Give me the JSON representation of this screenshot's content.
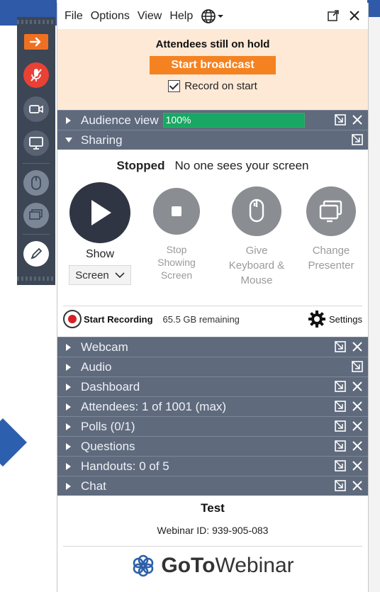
{
  "menu": {
    "file": "File",
    "options": "Options",
    "view": "View",
    "help": "Help"
  },
  "hold": {
    "title": "Attendees still on hold",
    "broadcast_button": "Start broadcast",
    "record_on_start": "Record on start",
    "record_on_start_checked": true
  },
  "audience_view": {
    "label": "Audience view",
    "percent_text": "100%",
    "progress_fraction": 1.0
  },
  "sharing": {
    "label": "Sharing",
    "status_bold": "Stopped",
    "status_text": "No one sees your screen",
    "buttons": {
      "show": "Show",
      "screen_select": "Screen",
      "stop_line1": "Stop",
      "stop_line2": "Showing",
      "stop_line3": "Screen",
      "give_line1": "Give",
      "give_line2": "Keyboard &",
      "give_line3": "Mouse",
      "change_line1": "Change",
      "change_line2": "Presenter"
    },
    "recording": {
      "start_label": "Start Recording",
      "remaining": "65.5 GB remaining",
      "settings": "Settings"
    }
  },
  "sections": [
    {
      "label": "Webcam",
      "icons": [
        "popout-icon",
        "close-icon"
      ]
    },
    {
      "label": "Audio",
      "icons": [
        "popout-icon"
      ]
    },
    {
      "label": "Dashboard",
      "icons": [
        "popout-icon",
        "close-icon"
      ]
    },
    {
      "label": "Attendees:  1 of 1001 (max)",
      "icons": [
        "popout-icon",
        "close-icon"
      ]
    },
    {
      "label": "Polls (0/1)",
      "icons": [
        "popout-icon",
        "close-icon"
      ]
    },
    {
      "label": "Questions",
      "icons": [
        "popout-icon",
        "close-icon"
      ]
    },
    {
      "label": "Handouts: 0 of 5",
      "icons": [
        "popout-icon",
        "close-icon"
      ]
    },
    {
      "label": "Chat",
      "icons": [
        "popout-icon",
        "close-icon"
      ]
    }
  ],
  "footer": {
    "webinar_name": "Test",
    "webinar_id": "Webinar ID: 939-905-083",
    "logo_bold": "GoTo",
    "logo_regular": "Webinar"
  },
  "colors": {
    "accent_orange": "#f58220",
    "hold_background": "#fde9d5",
    "section_bar": "#5f6a7d",
    "progress_green": "#18a863",
    "toolbar": "#3c4654",
    "mic_muted_red": "#e94135"
  }
}
